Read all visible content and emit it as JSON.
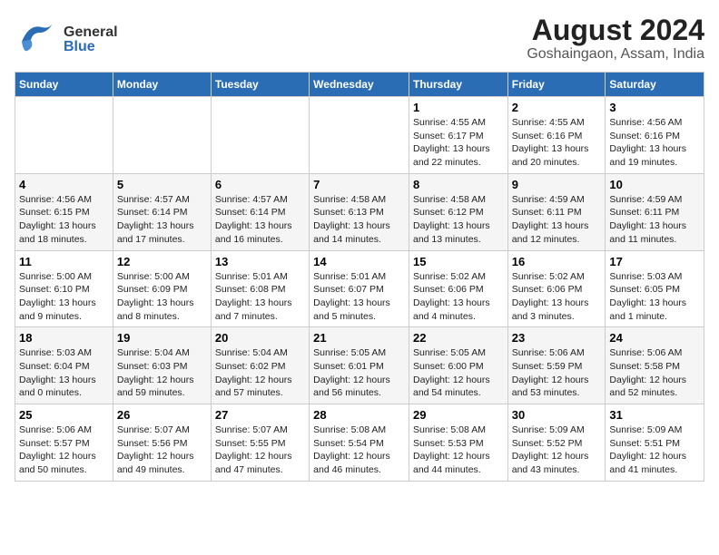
{
  "header": {
    "logo_general": "General",
    "logo_blue": "Blue",
    "title": "August 2024",
    "subtitle": "Goshaingaon, Assam, India"
  },
  "calendar": {
    "days_of_week": [
      "Sunday",
      "Monday",
      "Tuesday",
      "Wednesday",
      "Thursday",
      "Friday",
      "Saturday"
    ],
    "weeks": [
      [
        {
          "day": "",
          "info": ""
        },
        {
          "day": "",
          "info": ""
        },
        {
          "day": "",
          "info": ""
        },
        {
          "day": "",
          "info": ""
        },
        {
          "day": "1",
          "info": "Sunrise: 4:55 AM\nSunset: 6:17 PM\nDaylight: 13 hours\nand 22 minutes."
        },
        {
          "day": "2",
          "info": "Sunrise: 4:55 AM\nSunset: 6:16 PM\nDaylight: 13 hours\nand 20 minutes."
        },
        {
          "day": "3",
          "info": "Sunrise: 4:56 AM\nSunset: 6:16 PM\nDaylight: 13 hours\nand 19 minutes."
        }
      ],
      [
        {
          "day": "4",
          "info": "Sunrise: 4:56 AM\nSunset: 6:15 PM\nDaylight: 13 hours\nand 18 minutes."
        },
        {
          "day": "5",
          "info": "Sunrise: 4:57 AM\nSunset: 6:14 PM\nDaylight: 13 hours\nand 17 minutes."
        },
        {
          "day": "6",
          "info": "Sunrise: 4:57 AM\nSunset: 6:14 PM\nDaylight: 13 hours\nand 16 minutes."
        },
        {
          "day": "7",
          "info": "Sunrise: 4:58 AM\nSunset: 6:13 PM\nDaylight: 13 hours\nand 14 minutes."
        },
        {
          "day": "8",
          "info": "Sunrise: 4:58 AM\nSunset: 6:12 PM\nDaylight: 13 hours\nand 13 minutes."
        },
        {
          "day": "9",
          "info": "Sunrise: 4:59 AM\nSunset: 6:11 PM\nDaylight: 13 hours\nand 12 minutes."
        },
        {
          "day": "10",
          "info": "Sunrise: 4:59 AM\nSunset: 6:11 PM\nDaylight: 13 hours\nand 11 minutes."
        }
      ],
      [
        {
          "day": "11",
          "info": "Sunrise: 5:00 AM\nSunset: 6:10 PM\nDaylight: 13 hours\nand 9 minutes."
        },
        {
          "day": "12",
          "info": "Sunrise: 5:00 AM\nSunset: 6:09 PM\nDaylight: 13 hours\nand 8 minutes."
        },
        {
          "day": "13",
          "info": "Sunrise: 5:01 AM\nSunset: 6:08 PM\nDaylight: 13 hours\nand 7 minutes."
        },
        {
          "day": "14",
          "info": "Sunrise: 5:01 AM\nSunset: 6:07 PM\nDaylight: 13 hours\nand 5 minutes."
        },
        {
          "day": "15",
          "info": "Sunrise: 5:02 AM\nSunset: 6:06 PM\nDaylight: 13 hours\nand 4 minutes."
        },
        {
          "day": "16",
          "info": "Sunrise: 5:02 AM\nSunset: 6:06 PM\nDaylight: 13 hours\nand 3 minutes."
        },
        {
          "day": "17",
          "info": "Sunrise: 5:03 AM\nSunset: 6:05 PM\nDaylight: 13 hours\nand 1 minute."
        }
      ],
      [
        {
          "day": "18",
          "info": "Sunrise: 5:03 AM\nSunset: 6:04 PM\nDaylight: 13 hours\nand 0 minutes."
        },
        {
          "day": "19",
          "info": "Sunrise: 5:04 AM\nSunset: 6:03 PM\nDaylight: 12 hours\nand 59 minutes."
        },
        {
          "day": "20",
          "info": "Sunrise: 5:04 AM\nSunset: 6:02 PM\nDaylight: 12 hours\nand 57 minutes."
        },
        {
          "day": "21",
          "info": "Sunrise: 5:05 AM\nSunset: 6:01 PM\nDaylight: 12 hours\nand 56 minutes."
        },
        {
          "day": "22",
          "info": "Sunrise: 5:05 AM\nSunset: 6:00 PM\nDaylight: 12 hours\nand 54 minutes."
        },
        {
          "day": "23",
          "info": "Sunrise: 5:06 AM\nSunset: 5:59 PM\nDaylight: 12 hours\nand 53 minutes."
        },
        {
          "day": "24",
          "info": "Sunrise: 5:06 AM\nSunset: 5:58 PM\nDaylight: 12 hours\nand 52 minutes."
        }
      ],
      [
        {
          "day": "25",
          "info": "Sunrise: 5:06 AM\nSunset: 5:57 PM\nDaylight: 12 hours\nand 50 minutes."
        },
        {
          "day": "26",
          "info": "Sunrise: 5:07 AM\nSunset: 5:56 PM\nDaylight: 12 hours\nand 49 minutes."
        },
        {
          "day": "27",
          "info": "Sunrise: 5:07 AM\nSunset: 5:55 PM\nDaylight: 12 hours\nand 47 minutes."
        },
        {
          "day": "28",
          "info": "Sunrise: 5:08 AM\nSunset: 5:54 PM\nDaylight: 12 hours\nand 46 minutes."
        },
        {
          "day": "29",
          "info": "Sunrise: 5:08 AM\nSunset: 5:53 PM\nDaylight: 12 hours\nand 44 minutes."
        },
        {
          "day": "30",
          "info": "Sunrise: 5:09 AM\nSunset: 5:52 PM\nDaylight: 12 hours\nand 43 minutes."
        },
        {
          "day": "31",
          "info": "Sunrise: 5:09 AM\nSunset: 5:51 PM\nDaylight: 12 hours\nand 41 minutes."
        }
      ]
    ]
  }
}
